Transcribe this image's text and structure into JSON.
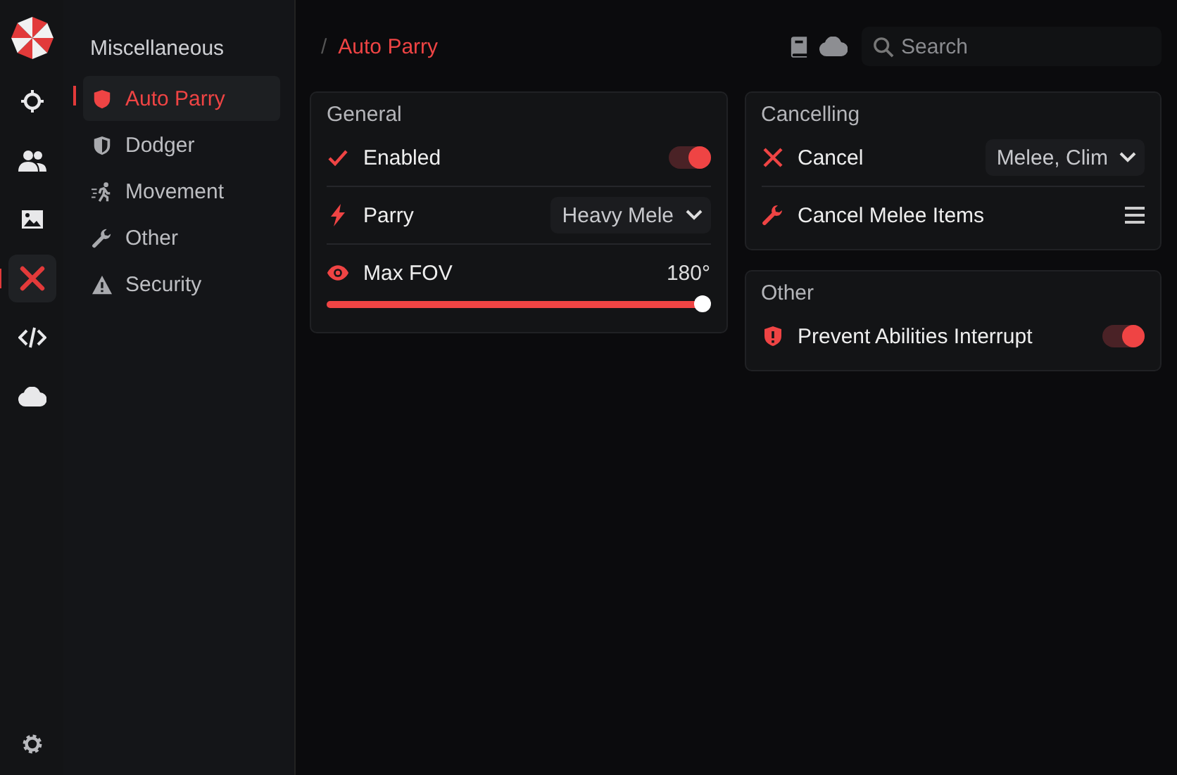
{
  "rail": {
    "items": [
      {
        "selected": false
      },
      {
        "selected": false
      },
      {
        "selected": false
      },
      {
        "selected": true
      },
      {
        "selected": false
      },
      {
        "selected": false
      }
    ]
  },
  "sidebar": {
    "title": "Miscellaneous",
    "items": [
      {
        "label": "Auto Parry",
        "selected": true
      },
      {
        "label": "Dodger",
        "selected": false
      },
      {
        "label": "Movement",
        "selected": false
      },
      {
        "label": "Other",
        "selected": false
      },
      {
        "label": "Security",
        "selected": false
      }
    ]
  },
  "breadcrumb": {
    "separator": "/",
    "current": "Auto Parry"
  },
  "search": {
    "placeholder": "Search"
  },
  "columns": [
    {
      "panels": [
        {
          "title": "General",
          "rows": [
            {
              "kind": "toggle",
              "label": "Enabled",
              "on": true
            },
            {
              "kind": "dropdown",
              "label": "Parry",
              "value": "Heavy Mele"
            },
            {
              "kind": "slider",
              "label": "Max FOV",
              "reading": "180°",
              "level": 1
            }
          ]
        }
      ]
    },
    {
      "panels": [
        {
          "title": "Cancelling",
          "rows": [
            {
              "kind": "dropdown",
              "label": "Cancel",
              "value": "Melee, Clim"
            },
            {
              "kind": "list",
              "label": "Cancel Melee Items"
            }
          ]
        },
        {
          "title": "Other",
          "rows": [
            {
              "kind": "toggle",
              "label": "Prevent Abilities Interrupt",
              "on": true
            }
          ]
        }
      ]
    }
  ]
}
